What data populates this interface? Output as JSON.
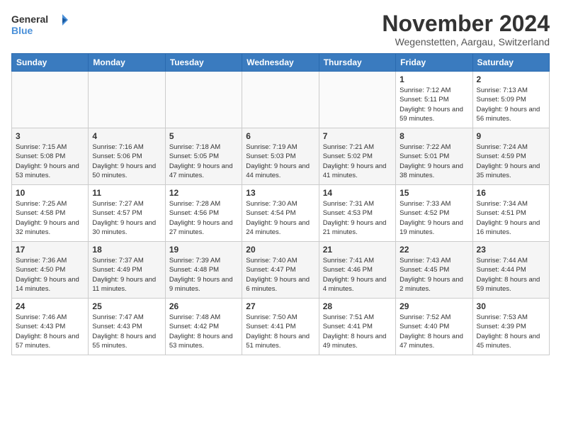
{
  "logo": {
    "line1": "General",
    "line2": "Blue"
  },
  "title": "November 2024",
  "subtitle": "Wegenstetten, Aargau, Switzerland",
  "days_of_week": [
    "Sunday",
    "Monday",
    "Tuesday",
    "Wednesday",
    "Thursday",
    "Friday",
    "Saturday"
  ],
  "weeks": [
    [
      {
        "day": "",
        "info": ""
      },
      {
        "day": "",
        "info": ""
      },
      {
        "day": "",
        "info": ""
      },
      {
        "day": "",
        "info": ""
      },
      {
        "day": "",
        "info": ""
      },
      {
        "day": "1",
        "info": "Sunrise: 7:12 AM\nSunset: 5:11 PM\nDaylight: 9 hours and 59 minutes."
      },
      {
        "day": "2",
        "info": "Sunrise: 7:13 AM\nSunset: 5:09 PM\nDaylight: 9 hours and 56 minutes."
      }
    ],
    [
      {
        "day": "3",
        "info": "Sunrise: 7:15 AM\nSunset: 5:08 PM\nDaylight: 9 hours and 53 minutes."
      },
      {
        "day": "4",
        "info": "Sunrise: 7:16 AM\nSunset: 5:06 PM\nDaylight: 9 hours and 50 minutes."
      },
      {
        "day": "5",
        "info": "Sunrise: 7:18 AM\nSunset: 5:05 PM\nDaylight: 9 hours and 47 minutes."
      },
      {
        "day": "6",
        "info": "Sunrise: 7:19 AM\nSunset: 5:03 PM\nDaylight: 9 hours and 44 minutes."
      },
      {
        "day": "7",
        "info": "Sunrise: 7:21 AM\nSunset: 5:02 PM\nDaylight: 9 hours and 41 minutes."
      },
      {
        "day": "8",
        "info": "Sunrise: 7:22 AM\nSunset: 5:01 PM\nDaylight: 9 hours and 38 minutes."
      },
      {
        "day": "9",
        "info": "Sunrise: 7:24 AM\nSunset: 4:59 PM\nDaylight: 9 hours and 35 minutes."
      }
    ],
    [
      {
        "day": "10",
        "info": "Sunrise: 7:25 AM\nSunset: 4:58 PM\nDaylight: 9 hours and 32 minutes."
      },
      {
        "day": "11",
        "info": "Sunrise: 7:27 AM\nSunset: 4:57 PM\nDaylight: 9 hours and 30 minutes."
      },
      {
        "day": "12",
        "info": "Sunrise: 7:28 AM\nSunset: 4:56 PM\nDaylight: 9 hours and 27 minutes."
      },
      {
        "day": "13",
        "info": "Sunrise: 7:30 AM\nSunset: 4:54 PM\nDaylight: 9 hours and 24 minutes."
      },
      {
        "day": "14",
        "info": "Sunrise: 7:31 AM\nSunset: 4:53 PM\nDaylight: 9 hours and 21 minutes."
      },
      {
        "day": "15",
        "info": "Sunrise: 7:33 AM\nSunset: 4:52 PM\nDaylight: 9 hours and 19 minutes."
      },
      {
        "day": "16",
        "info": "Sunrise: 7:34 AM\nSunset: 4:51 PM\nDaylight: 9 hours and 16 minutes."
      }
    ],
    [
      {
        "day": "17",
        "info": "Sunrise: 7:36 AM\nSunset: 4:50 PM\nDaylight: 9 hours and 14 minutes."
      },
      {
        "day": "18",
        "info": "Sunrise: 7:37 AM\nSunset: 4:49 PM\nDaylight: 9 hours and 11 minutes."
      },
      {
        "day": "19",
        "info": "Sunrise: 7:39 AM\nSunset: 4:48 PM\nDaylight: 9 hours and 9 minutes."
      },
      {
        "day": "20",
        "info": "Sunrise: 7:40 AM\nSunset: 4:47 PM\nDaylight: 9 hours and 6 minutes."
      },
      {
        "day": "21",
        "info": "Sunrise: 7:41 AM\nSunset: 4:46 PM\nDaylight: 9 hours and 4 minutes."
      },
      {
        "day": "22",
        "info": "Sunrise: 7:43 AM\nSunset: 4:45 PM\nDaylight: 9 hours and 2 minutes."
      },
      {
        "day": "23",
        "info": "Sunrise: 7:44 AM\nSunset: 4:44 PM\nDaylight: 8 hours and 59 minutes."
      }
    ],
    [
      {
        "day": "24",
        "info": "Sunrise: 7:46 AM\nSunset: 4:43 PM\nDaylight: 8 hours and 57 minutes."
      },
      {
        "day": "25",
        "info": "Sunrise: 7:47 AM\nSunset: 4:43 PM\nDaylight: 8 hours and 55 minutes."
      },
      {
        "day": "26",
        "info": "Sunrise: 7:48 AM\nSunset: 4:42 PM\nDaylight: 8 hours and 53 minutes."
      },
      {
        "day": "27",
        "info": "Sunrise: 7:50 AM\nSunset: 4:41 PM\nDaylight: 8 hours and 51 minutes."
      },
      {
        "day": "28",
        "info": "Sunrise: 7:51 AM\nSunset: 4:41 PM\nDaylight: 8 hours and 49 minutes."
      },
      {
        "day": "29",
        "info": "Sunrise: 7:52 AM\nSunset: 4:40 PM\nDaylight: 8 hours and 47 minutes."
      },
      {
        "day": "30",
        "info": "Sunrise: 7:53 AM\nSunset: 4:39 PM\nDaylight: 8 hours and 45 minutes."
      }
    ]
  ],
  "colors": {
    "header_bg": "#3a7bbf",
    "shaded_row": "#f5f5f5",
    "white_row": "#ffffff"
  }
}
